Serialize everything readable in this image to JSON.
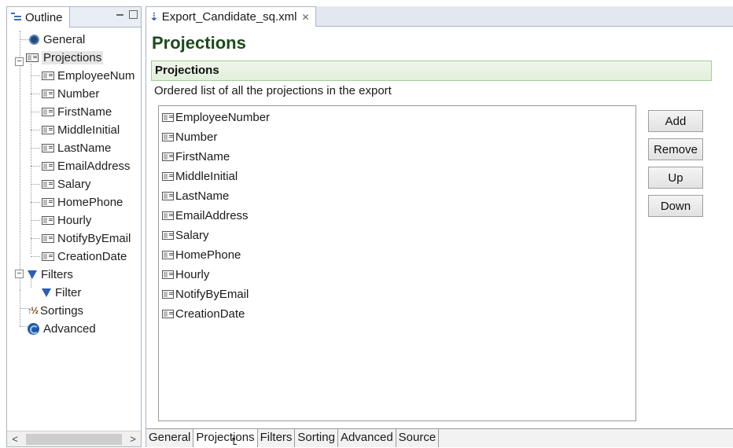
{
  "outline": {
    "tab_label": "Outline",
    "tree": {
      "general": "General",
      "projections": "Projections",
      "projection_items": [
        "EmployeeNum",
        "Number",
        "FirstName",
        "MiddleInitial",
        "LastName",
        "EmailAddress",
        "Salary",
        "HomePhone",
        "Hourly",
        "NotifyByEmail",
        "CreationDate"
      ],
      "filters": "Filters",
      "filter_child": "Filter",
      "sortings": "Sortings",
      "advanced": "Advanced"
    },
    "scroll_left": "<",
    "scroll_right": ">"
  },
  "editor": {
    "tab_label": "Export_Candidate_sq.xml",
    "tab_close": "✕",
    "page_title": "Projections",
    "section_title": "Projections",
    "section_description": "Ordered list of all the projections in the export",
    "projections": [
      "EmployeeNumber",
      "Number",
      "FirstName",
      "MiddleInitial",
      "LastName",
      "EmailAddress",
      "Salary",
      "HomePhone",
      "Hourly",
      "NotifyByEmail",
      "CreationDate"
    ],
    "buttons": {
      "add": "Add",
      "remove": "Remove",
      "up": "Up",
      "down": "Down"
    },
    "bottom_tabs": [
      "General",
      "Projections",
      "Filters",
      "Sorting",
      "Advanced",
      "Source"
    ],
    "active_bottom_tab": "Projections"
  }
}
